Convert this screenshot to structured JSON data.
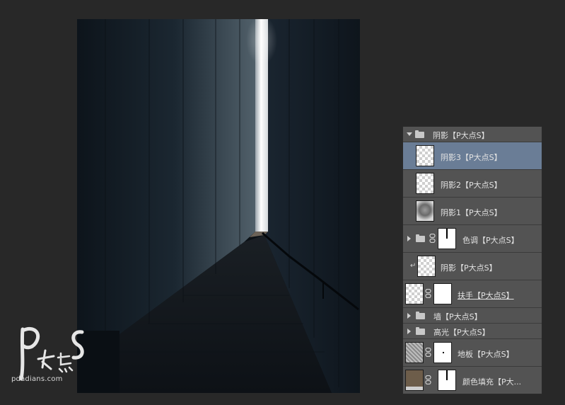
{
  "watermark": {
    "logo_text": "P大点S",
    "site": "pdadians.com"
  },
  "layers": [
    {
      "label": "阴影【P大点S】",
      "type": "group-open"
    },
    {
      "label": "阴影3【P大点S】",
      "type": "layer",
      "selected": true
    },
    {
      "label": "阴影2【P大点S】",
      "type": "layer"
    },
    {
      "label": "阴影1【P大点S】",
      "type": "layer"
    },
    {
      "label": "色调【P大点S】",
      "type": "group-masked"
    },
    {
      "label": "阴影【P大点S】",
      "type": "clipped-layer"
    },
    {
      "label": "扶手【P大点S】",
      "type": "masked-layer"
    },
    {
      "label": "墙【P大点S】",
      "type": "group"
    },
    {
      "label": "高光【P大点S】",
      "type": "group"
    },
    {
      "label": "地板【P大点S】",
      "type": "masked-layer"
    },
    {
      "label": "颜色填充【P大...",
      "type": "fill-layer"
    }
  ],
  "colors": {
    "selected_row": "#6a7d96",
    "fill_swatch": "#6d5d4a",
    "panel_bg": "#535353"
  },
  "icons": [
    "folder-icon",
    "chain-link-icon",
    "disclosure-triangle-icon",
    "clipping-arrow-icon"
  ]
}
